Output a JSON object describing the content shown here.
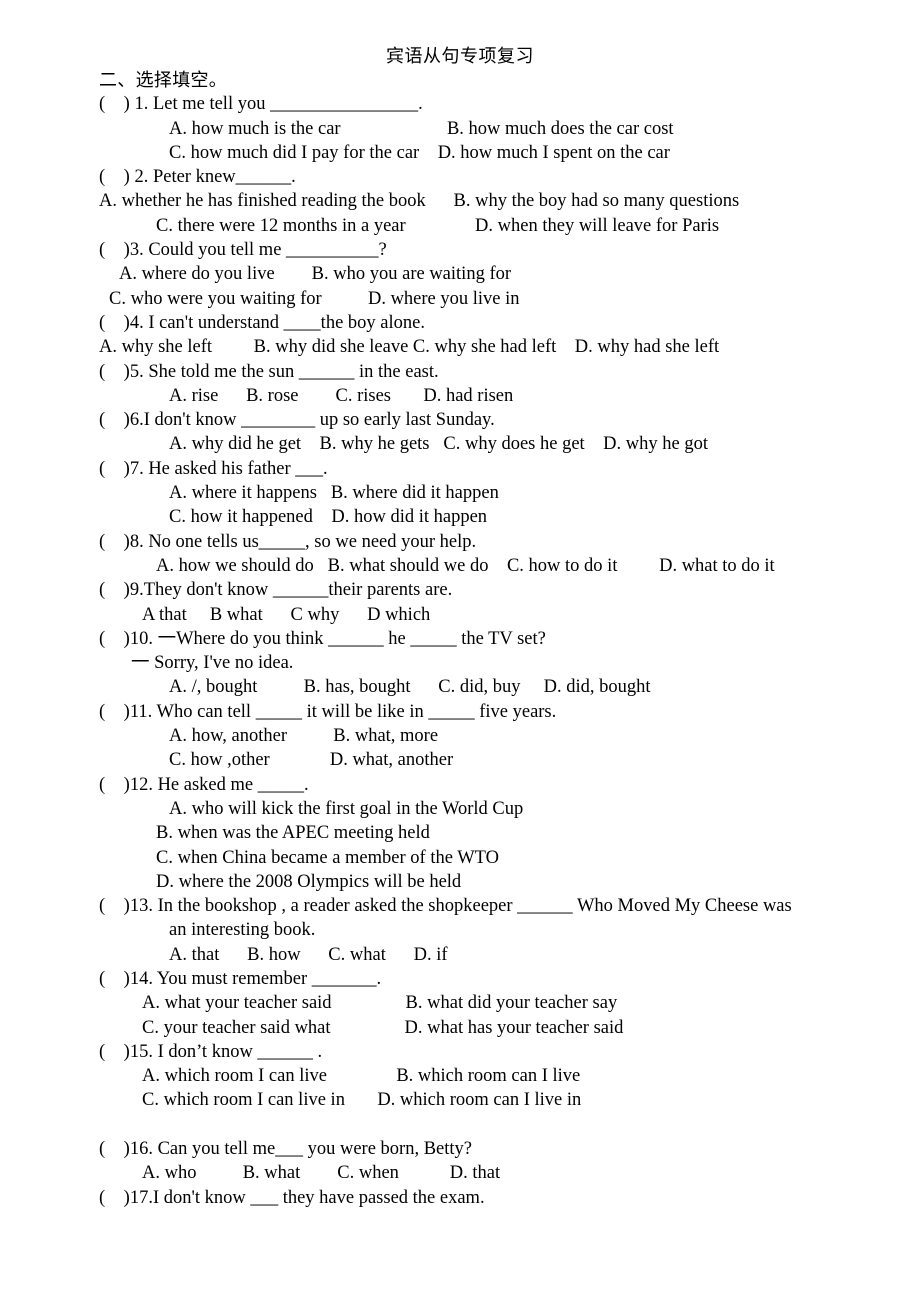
{
  "document": {
    "title": "宾语从句专项复习",
    "section_heading": "二、选择填空。"
  },
  "questions": [
    {
      "stem": "(    ) 1. Let me tell you ________________.",
      "lines": [
        "A. how much is the car                       B. how much does the car cost",
        "C. how much did I pay for the car    D. how much I spent on the car"
      ]
    },
    {
      "stem": "(    ) 2. Peter knew______.",
      "lines": [
        "A. whether he has finished reading the book      B. why the boy had so many questions",
        "C. there were 12 months in a year               D. when they will leave for Paris"
      ]
    },
    {
      "stem": "(    )3. Could you tell me __________?",
      "lines": [
        "A. where do you live        B. who you are waiting for",
        "C. who were you waiting for          D. where you live in"
      ]
    },
    {
      "stem": "(    )4. I can't understand ____the boy alone.",
      "lines": [
        "A. why she left         B. why did she leave C. why she had left    D. why had she left"
      ]
    },
    {
      "stem": "(    )5. She told me the sun ______ in the east.",
      "lines": [
        "A. rise      B. rose        C. rises       D. had risen"
      ]
    },
    {
      "stem": "(    )6.I don't know ________ up so early last Sunday.",
      "lines": [
        "A. why did he get    B. why he gets   C. why does he get    D. why he got"
      ]
    },
    {
      "stem": "(    )7. He asked his father ___.",
      "lines": [
        "A. where it happens   B. where did it happen",
        "C. how it happened    D. how did it happen"
      ]
    },
    {
      "stem": "(    )8. No one tells us_____, so we need your help.",
      "lines": [
        "A. how we should do   B. what should we do    C. how to do it         D. what to do it"
      ]
    },
    {
      "stem": "(    )9.They don't know ______their parents are.",
      "lines": [
        "A that     B what      C why      D which"
      ]
    },
    {
      "stem": "(    )10. 一Where do you think ______ he _____ the TV set?",
      "lines": [
        "一 Sorry, I've no idea.",
        "A. /, bought          B. has, bought      C. did, buy     D. did, bought"
      ]
    },
    {
      "stem": "(    )11. Who can tell _____ it will be like in _____ five years.",
      "lines": [
        "A. how, another          B. what, more",
        "C. how ,other             D. what, another"
      ]
    },
    {
      "stem": "(    )12. He asked me _____.",
      "lines": [
        "A. who will kick the first goal in the World Cup",
        "B. when was the APEC meeting held",
        "C. when China became a member of the WTO",
        "D. where the 2008 Olympics will be held"
      ]
    },
    {
      "stem": "(    )13. In the bookshop , a reader asked the shopkeeper ______ Who Moved My Cheese was",
      "lines": [
        "an interesting book.",
        "A. that      B. how      C. what      D. if"
      ]
    },
    {
      "stem": "(    )14. You must remember _______.",
      "lines": [
        "A. what your teacher said                B. what did your teacher say",
        "C. your teacher said what                D. what has your teacher said"
      ]
    },
    {
      "stem": "(    )15. I don’t know ______ .",
      "lines": [
        "A. which room I can live               B. which room can I live",
        "C. which room I can live in       D. which room can I live in"
      ]
    },
    {
      "stem": "(    )16. Can you tell me___ you were born, Betty?",
      "lines": [
        "A. who          B. what        C. when           D. that"
      ]
    },
    {
      "stem": "(    )17.I don't know ___ they have passed the exam.",
      "lines": []
    }
  ]
}
